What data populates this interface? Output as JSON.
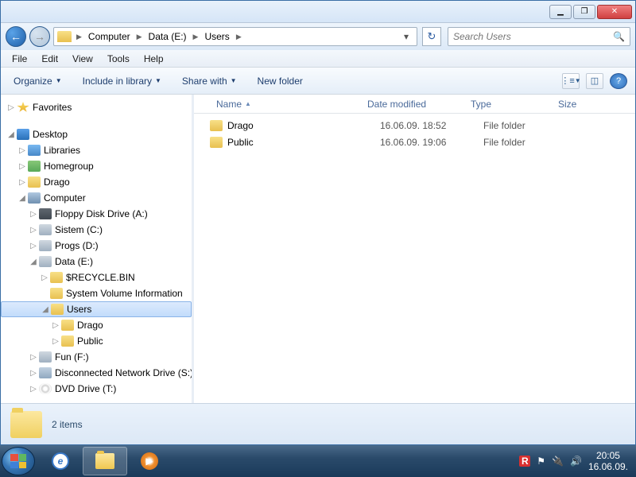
{
  "titlebar": {
    "min": "▁",
    "max": "❐",
    "close": "✕"
  },
  "addr": {
    "path": [
      "Computer",
      "Data (E:)",
      "Users"
    ],
    "refresh": "↻",
    "searchPlaceholder": "Search Users"
  },
  "menu": [
    "File",
    "Edit",
    "View",
    "Tools",
    "Help"
  ],
  "toolbar": {
    "organize": "Organize",
    "include": "Include in library",
    "share": "Share with",
    "newfolder": "New folder"
  },
  "tree": {
    "favorites": "Favorites",
    "desktop": "Desktop",
    "libraries": "Libraries",
    "homegroup": "Homegroup",
    "drago": "Drago",
    "computer": "Computer",
    "floppy": "Floppy Disk Drive (A:)",
    "sistem": "Sistem (C:)",
    "progs": "Progs (D:)",
    "data": "Data (E:)",
    "recycle": "$RECYCLE.BIN",
    "svi": "System Volume Information",
    "users": "Users",
    "uDrago": "Drago",
    "uPublic": "Public",
    "fun": "Fun (F:)",
    "netdrive": "Disconnected Network Drive (S:)",
    "dvd": "DVD Drive (T:)"
  },
  "cols": {
    "name": "Name",
    "date": "Date modified",
    "type": "Type",
    "size": "Size"
  },
  "rows": [
    {
      "name": "Drago",
      "date": "16.06.09. 18:52",
      "type": "File folder"
    },
    {
      "name": "Public",
      "date": "16.06.09. 19:06",
      "type": "File folder"
    }
  ],
  "status": "2 items",
  "tray": {
    "time": "20:05",
    "date": "16.06.09."
  }
}
